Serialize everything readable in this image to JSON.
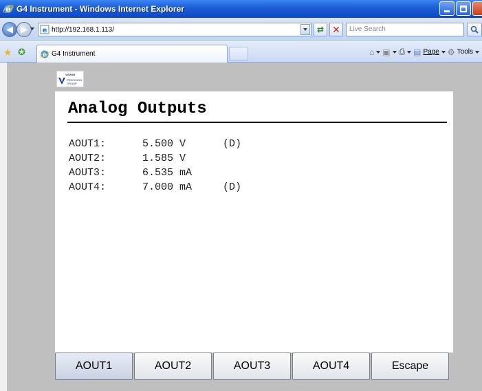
{
  "window": {
    "title": "G4 Instrument - Windows Internet Explorer"
  },
  "address_bar": {
    "url": "http://192.168.1.113/",
    "search_placeholder": "Live Search"
  },
  "tabs": {
    "active_tab_label": "G4 Instrument"
  },
  "command_bar": {
    "page_label": "Page",
    "tools_label": "Tools"
  },
  "logo": {
    "line1": "VISHAY",
    "line2": "PRECISION",
    "line3": "GROUP"
  },
  "panel": {
    "title": "Analog Outputs",
    "readings": [
      {
        "label": "AOUT1:",
        "value": "5.500 V",
        "flag": "(D)"
      },
      {
        "label": "AOUT2:",
        "value": "1.585 V",
        "flag": ""
      },
      {
        "label": "AOUT3:",
        "value": "6.535 mA",
        "flag": ""
      },
      {
        "label": "AOUT4:",
        "value": "7.000 mA",
        "flag": "(D)"
      }
    ]
  },
  "softkeys": [
    "AOUT1",
    "AOUT2",
    "AOUT3",
    "AOUT4",
    "Escape"
  ],
  "colors": {
    "titlebar": "#1f5fd8",
    "page_background": "#bfbfbf",
    "panel_background": "#ffffff"
  }
}
